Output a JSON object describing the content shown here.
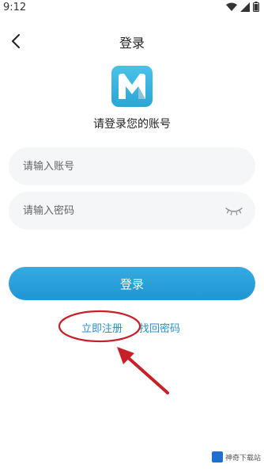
{
  "status_bar": {
    "time": "9:12",
    "icons": [
      "wifi-icon",
      "signal-icon",
      "battery-icon"
    ]
  },
  "header": {
    "title": "登录",
    "back_icon": "chevron-left-icon"
  },
  "logo": {
    "letter": "M",
    "color": "#3db6e4"
  },
  "subtitle": "请登录您的账号",
  "form": {
    "account_placeholder": "请输入账号",
    "account_value": "",
    "password_placeholder": "请输入密码",
    "password_value": "",
    "password_toggle_icon": "eye-closed-icon"
  },
  "buttons": {
    "login_label": "登录"
  },
  "links": {
    "register": "立即注册",
    "forgot": "找回密码"
  },
  "watermark": {
    "text": "神奇下载站"
  },
  "colors": {
    "accent": "#2a9fd8",
    "link": "#2a8fcf",
    "annotation": "#c8202a",
    "field_bg": "#f5f6f8"
  }
}
